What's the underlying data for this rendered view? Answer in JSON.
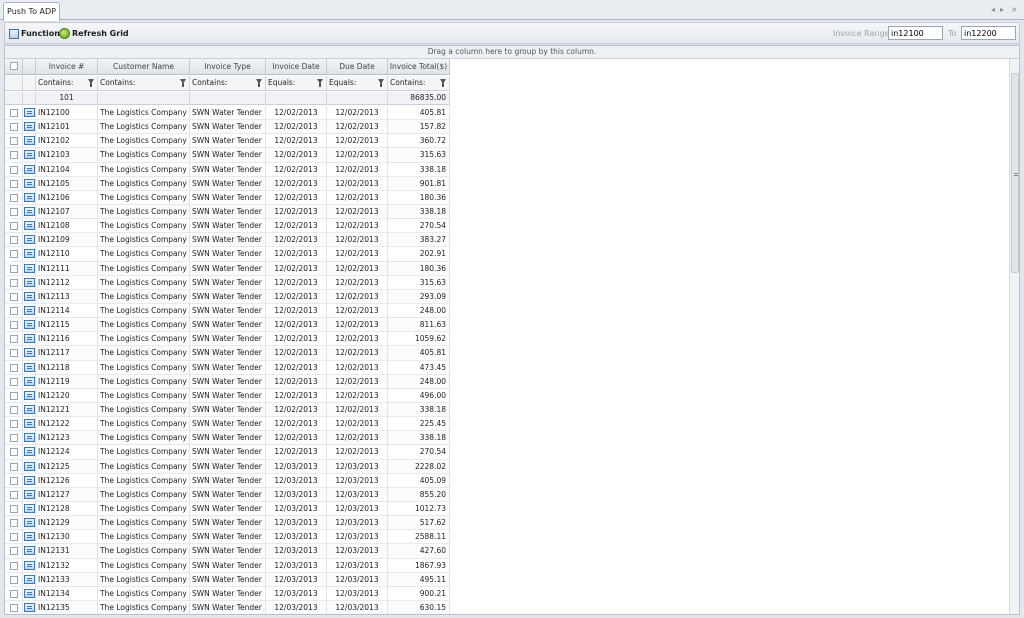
{
  "tab": {
    "label": "Push To ADP"
  },
  "toolbar": {
    "functions_label": "Functions",
    "refresh_label": "Refresh Grid",
    "range_label": "Invoice Range:",
    "range_from": "in12100",
    "to_label": "To",
    "range_to": "in12200"
  },
  "grid": {
    "group_hint": "Drag a column here to group by this column.",
    "columns": [
      "Invoice #",
      "Customer Name",
      "Invoice Type",
      "Invoice Date",
      "Due Date",
      "Invoice Total($)"
    ],
    "filters": [
      "Contains:",
      "Contains:",
      "Contains:",
      "Equals:",
      "Equals:",
      "Contains:"
    ],
    "aggregate": {
      "count": "101",
      "total": "86835.00"
    },
    "rows": [
      [
        "IN12100",
        "The Logistics Company",
        "SWN Water Tender",
        "12/02/2013",
        "12/02/2013",
        "405.81"
      ],
      [
        "IN12101",
        "The Logistics Company",
        "SWN Water Tender",
        "12/02/2013",
        "12/02/2013",
        "157.82"
      ],
      [
        "IN12102",
        "The Logistics Company",
        "SWN Water Tender",
        "12/02/2013",
        "12/02/2013",
        "360.72"
      ],
      [
        "IN12103",
        "The Logistics Company",
        "SWN Water Tender",
        "12/02/2013",
        "12/02/2013",
        "315.63"
      ],
      [
        "IN12104",
        "The Logistics Company",
        "SWN Water Tender",
        "12/02/2013",
        "12/02/2013",
        "338.18"
      ],
      [
        "IN12105",
        "The Logistics Company",
        "SWN Water Tender",
        "12/02/2013",
        "12/02/2013",
        "901.81"
      ],
      [
        "IN12106",
        "The Logistics Company",
        "SWN Water Tender",
        "12/02/2013",
        "12/02/2013",
        "180.36"
      ],
      [
        "IN12107",
        "The Logistics Company",
        "SWN Water Tender",
        "12/02/2013",
        "12/02/2013",
        "338.18"
      ],
      [
        "IN12108",
        "The Logistics Company",
        "SWN Water Tender",
        "12/02/2013",
        "12/02/2013",
        "270.54"
      ],
      [
        "IN12109",
        "The Logistics Company",
        "SWN Water Tender",
        "12/02/2013",
        "12/02/2013",
        "383.27"
      ],
      [
        "IN12110",
        "The Logistics Company",
        "SWN Water Tender",
        "12/02/2013",
        "12/02/2013",
        "202.91"
      ],
      [
        "IN12111",
        "The Logistics Company",
        "SWN Water Tender",
        "12/02/2013",
        "12/02/2013",
        "180.36"
      ],
      [
        "IN12112",
        "The Logistics Company",
        "SWN Water Tender",
        "12/02/2013",
        "12/02/2013",
        "315.63"
      ],
      [
        "IN12113",
        "The Logistics Company",
        "SWN Water Tender",
        "12/02/2013",
        "12/02/2013",
        "293.09"
      ],
      [
        "IN12114",
        "The Logistics Company",
        "SWN Water Tender",
        "12/02/2013",
        "12/02/2013",
        "248.00"
      ],
      [
        "IN12115",
        "The Logistics Company",
        "SWN Water Tender",
        "12/02/2013",
        "12/02/2013",
        "811.63"
      ],
      [
        "IN12116",
        "The Logistics Company",
        "SWN Water Tender",
        "12/02/2013",
        "12/02/2013",
        "1059.62"
      ],
      [
        "IN12117",
        "The Logistics Company",
        "SWN Water Tender",
        "12/02/2013",
        "12/02/2013",
        "405.81"
      ],
      [
        "IN12118",
        "The Logistics Company",
        "SWN Water Tender",
        "12/02/2013",
        "12/02/2013",
        "473.45"
      ],
      [
        "IN12119",
        "The Logistics Company",
        "SWN Water Tender",
        "12/02/2013",
        "12/02/2013",
        "248.00"
      ],
      [
        "IN12120",
        "The Logistics Company",
        "SWN Water Tender",
        "12/02/2013",
        "12/02/2013",
        "496.00"
      ],
      [
        "IN12121",
        "The Logistics Company",
        "SWN Water Tender",
        "12/02/2013",
        "12/02/2013",
        "338.18"
      ],
      [
        "IN12122",
        "The Logistics Company",
        "SWN Water Tender",
        "12/02/2013",
        "12/02/2013",
        "225.45"
      ],
      [
        "IN12123",
        "The Logistics Company",
        "SWN Water Tender",
        "12/02/2013",
        "12/02/2013",
        "338.18"
      ],
      [
        "IN12124",
        "The Logistics Company",
        "SWN Water Tender",
        "12/02/2013",
        "12/02/2013",
        "270.54"
      ],
      [
        "IN12125",
        "The Logistics Company",
        "SWN Water Tender",
        "12/03/2013",
        "12/03/2013",
        "2228.02"
      ],
      [
        "IN12126",
        "The Logistics Company",
        "SWN Water Tender",
        "12/03/2013",
        "12/03/2013",
        "405.09"
      ],
      [
        "IN12127",
        "The Logistics Company",
        "SWN Water Tender",
        "12/03/2013",
        "12/03/2013",
        "855.20"
      ],
      [
        "IN12128",
        "The Logistics Company",
        "SWN Water Tender",
        "12/03/2013",
        "12/03/2013",
        "1012.73"
      ],
      [
        "IN12129",
        "The Logistics Company",
        "SWN Water Tender",
        "12/03/2013",
        "12/03/2013",
        "517.62"
      ],
      [
        "IN12130",
        "The Logistics Company",
        "SWN Water Tender",
        "12/03/2013",
        "12/03/2013",
        "2588.11"
      ],
      [
        "IN12131",
        "The Logistics Company",
        "SWN Water Tender",
        "12/03/2013",
        "12/03/2013",
        "427.60"
      ],
      [
        "IN12132",
        "The Logistics Company",
        "SWN Water Tender",
        "12/03/2013",
        "12/03/2013",
        "1867.93"
      ],
      [
        "IN12133",
        "The Logistics Company",
        "SWN Water Tender",
        "12/03/2013",
        "12/03/2013",
        "495.11"
      ],
      [
        "IN12134",
        "The Logistics Company",
        "SWN Water Tender",
        "12/03/2013",
        "12/03/2013",
        "900.21"
      ],
      [
        "IN12135",
        "The Logistics Company",
        "SWN Water Tender",
        "12/03/2013",
        "12/03/2013",
        "630.15"
      ]
    ]
  }
}
